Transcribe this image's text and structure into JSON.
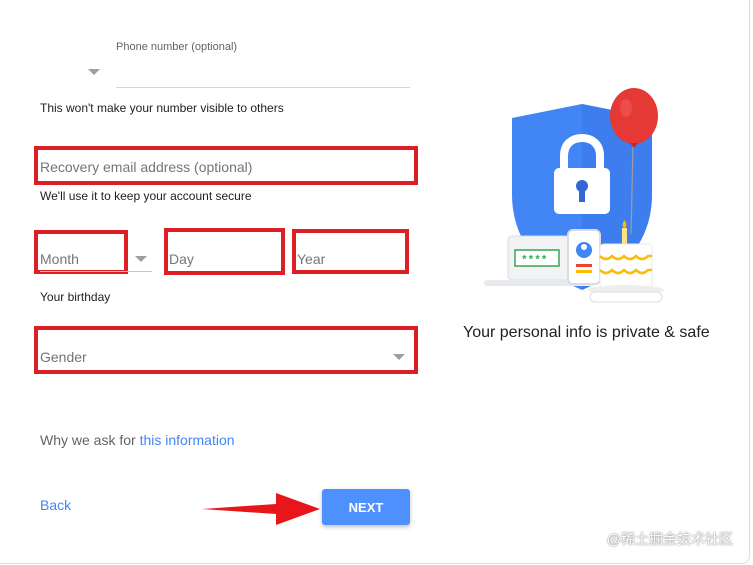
{
  "phone": {
    "label": "Phone number (optional)",
    "value": "",
    "hint": "This won't make your number visible to others"
  },
  "recovery": {
    "placeholder": "Recovery email address (optional)",
    "hint": "We'll use it to keep your account secure"
  },
  "birthday": {
    "month_selected": "Month",
    "day_placeholder": "Day",
    "year_placeholder": "Year",
    "label": "Your birthday"
  },
  "gender": {
    "selected": "Gender"
  },
  "why": {
    "prefix": "Why we ask for",
    "link": "this information"
  },
  "actions": {
    "back_label": "Back",
    "next_label": "NEXT"
  },
  "illustration": {
    "caption": "Your personal info is private & safe",
    "password_mask": "****"
  },
  "watermark": "@稀土掘金技术社区",
  "colors": {
    "accent_blue": "#4285f4",
    "next_button": "#4d90fe",
    "highlight_red": "#dc1f26",
    "arrow_red": "#e8161b",
    "shield_blue": "#4285f4",
    "balloon_red": "#e53935"
  }
}
